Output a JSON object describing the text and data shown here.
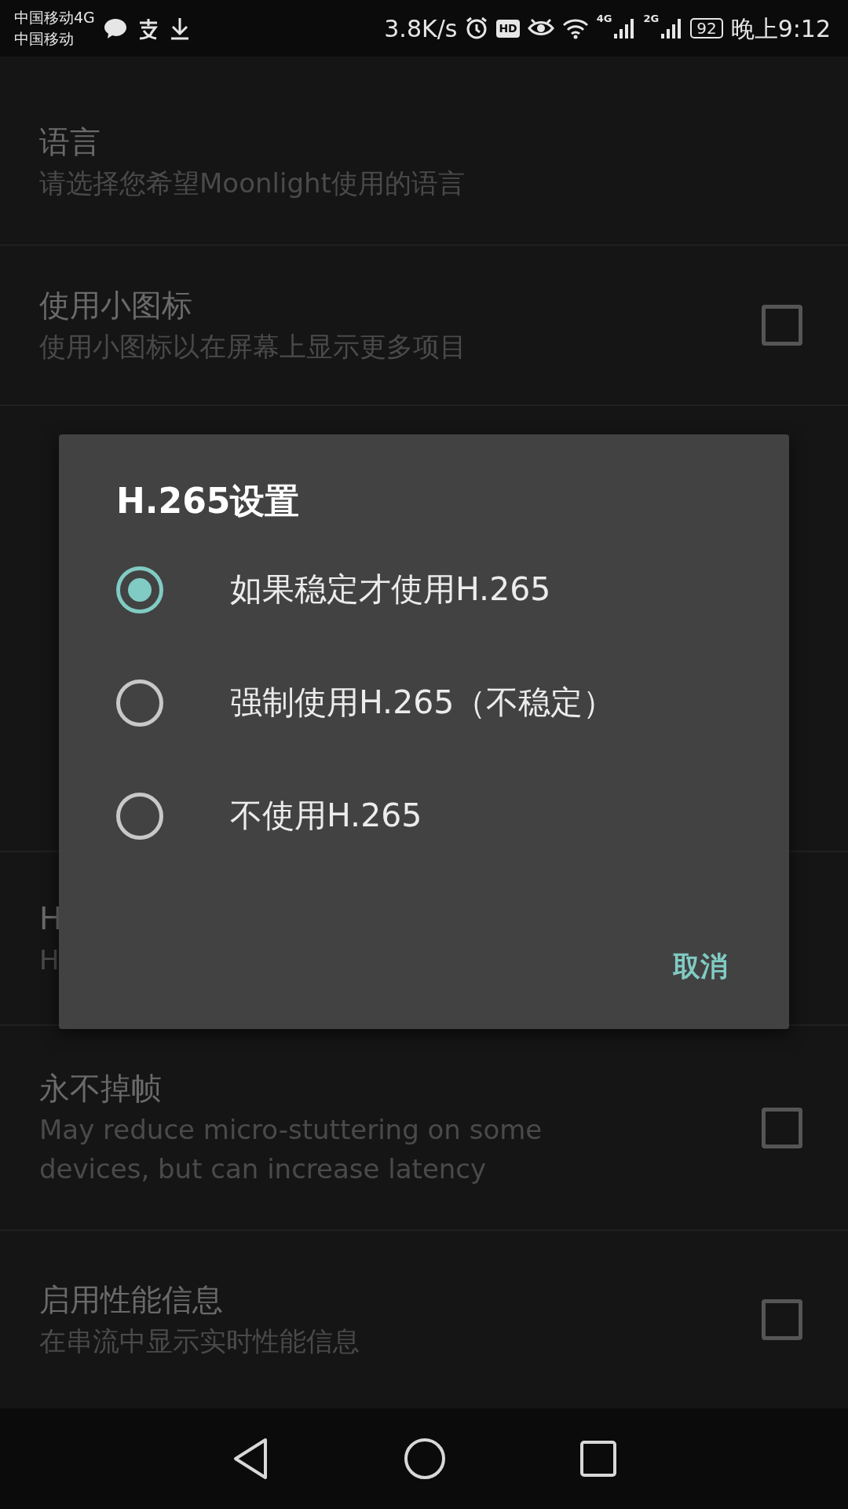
{
  "status_bar": {
    "carrier_1": "中国移动4G",
    "carrier_2": "中国移动",
    "speed": "3.8K/s",
    "hd": "HD",
    "network_1": "4G",
    "network_2": "2G",
    "battery": "92",
    "time": "晚上9:12"
  },
  "settings": [
    {
      "kind": "text",
      "title": "语言",
      "subtitle": "请选择您希望Moonlight使用的语言"
    },
    {
      "kind": "checkbox",
      "title": "使用小图标",
      "subtitle": "使用小图标以在屏幕上显示更多项目",
      "checked": false
    },
    {
      "kind": "covered",
      "title": "H",
      "subtitle": "H"
    },
    {
      "kind": "checkbox",
      "title": "永不掉帧",
      "subtitle": "May reduce micro-stuttering on some devices, but can increase latency",
      "checked": false
    },
    {
      "kind": "checkbox",
      "title": "启用性能信息",
      "subtitle": "在串流中显示实时性能信息",
      "checked": false
    }
  ],
  "dialog": {
    "title": "H.265设置",
    "options": [
      {
        "label": "如果稳定才使用H.265",
        "selected": true
      },
      {
        "label": "强制使用H.265（不稳定）",
        "selected": false
      },
      {
        "label": "不使用H.265",
        "selected": false
      }
    ],
    "cancel": "取消"
  }
}
